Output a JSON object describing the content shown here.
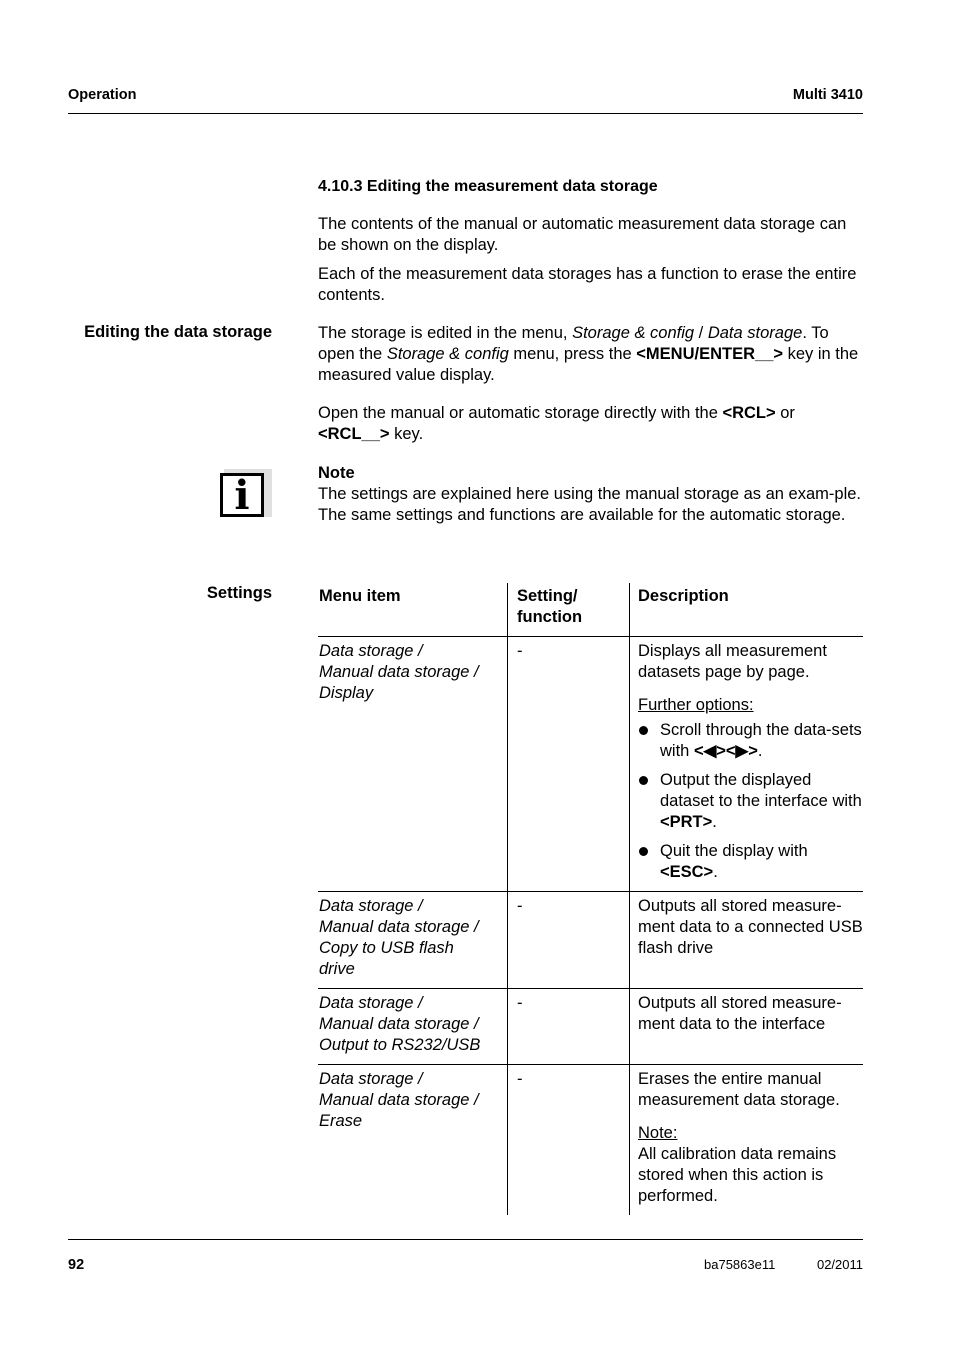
{
  "header": {
    "left": "Operation",
    "right": "Multi 3410"
  },
  "section": {
    "title": "4.10.3  Editing the measurement data storage",
    "intro_paragraphs": [
      "The contents of the manual or automatic measurement data storage can be shown on the display.",
      "Each of the measurement data storages has a function to erase the entire contents."
    ]
  },
  "editing": {
    "side_label": "Editing the data storage",
    "p1": {
      "t1": "The storage is edited in the menu, ",
      "menu_path_1": "Storage & config",
      "sep": " / ",
      "menu_path_2": "Data storage",
      "t2": ". To open the ",
      "menu_name": "Storage & config",
      "t3": " menu, press the ",
      "key": "<MENU/ENTER__>",
      "t4": " key in the measured value display."
    },
    "p2": {
      "t1": "Open the manual or automatic storage directly with the ",
      "key1": "<RCL>",
      "t2": " or ",
      "key2": "<RCL__>",
      "t3": " key."
    }
  },
  "note": {
    "icon": "info-icon",
    "icon_glyph": "i",
    "title": "Note",
    "text": "The settings are explained here using the manual storage as an exam-ple. The same settings and functions are available for the automatic storage."
  },
  "settings": {
    "side_label": "Settings",
    "columns": [
      "Menu item",
      "Setting/ function",
      "Description"
    ],
    "rows": [
      {
        "menu_lines": [
          "Data storage /",
          "Manual data storage /",
          "Display"
        ],
        "setting": "-",
        "description": "Displays all measurement datasets page by page.",
        "further_options_label": "Further options:",
        "options": [
          {
            "text": "Scroll through the data-sets with ",
            "key": "<◀><▶>",
            "after": "."
          },
          {
            "text": "Output the displayed dataset to the interface with ",
            "key": "<PRT>",
            "after": "."
          },
          {
            "text": "Quit the display with ",
            "key": "<ESC>",
            "after": "."
          }
        ]
      },
      {
        "menu_lines": [
          "Data storage /",
          "Manual data storage /",
          "Copy to USB flash",
          "drive"
        ],
        "setting": "-",
        "description": "Outputs all stored measure-ment data to a connected USB flash drive"
      },
      {
        "menu_lines": [
          "Data storage /",
          "Manual data storage /",
          "Output to RS232/USB"
        ],
        "setting": "-",
        "description": "Outputs all stored measure-ment data to the interface"
      },
      {
        "menu_lines": [
          "Data storage /",
          "Manual data storage /",
          "Erase"
        ],
        "setting": "-",
        "description": "Erases the entire manual measurement data storage.",
        "note_label": "Note:",
        "note_text": "All calibration data remains stored when this action is performed."
      }
    ]
  },
  "footer": {
    "page_number": "92",
    "doc_id": "ba75863e11",
    "date": "02/2011"
  }
}
